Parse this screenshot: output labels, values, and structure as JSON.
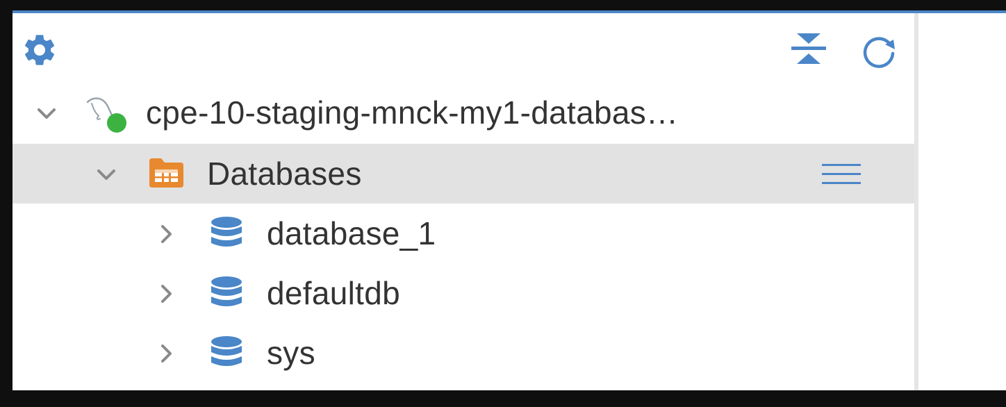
{
  "colors": {
    "accent": "#4a86c8",
    "folder": "#e8892f",
    "status_online": "#3cb341",
    "selected_row": "#e2e2e2"
  },
  "toolbar": {
    "settings_icon": "gear-icon",
    "collapse_icon": "collapse-all-icon",
    "refresh_icon": "refresh-icon"
  },
  "tree": {
    "connection": {
      "label": "cpe-10-staging-mnck-my1-databas…",
      "icon": "mysql-dolphin-icon",
      "status": "online",
      "expanded": true
    },
    "databases_folder": {
      "label": "Databases",
      "icon": "folder-table-icon",
      "expanded": true,
      "selected": true
    },
    "databases": [
      {
        "label": "database_1",
        "expanded": false
      },
      {
        "label": "defaultdb",
        "expanded": false
      },
      {
        "label": "sys",
        "expanded": false
      }
    ]
  }
}
